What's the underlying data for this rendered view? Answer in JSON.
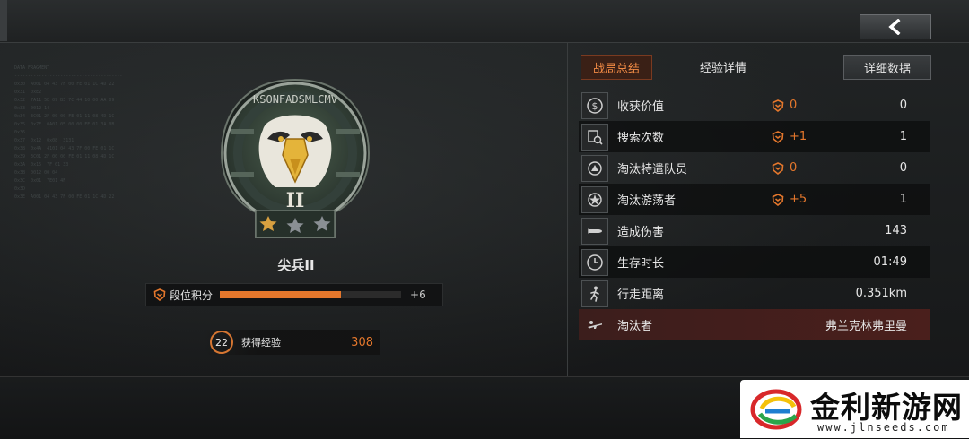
{
  "colors": {
    "accent": "#e4772c",
    "killer_bg": "#4a1f1c",
    "panel_bg": "#1c1e1f"
  },
  "header": {
    "back_icon": "chevron-left-icon"
  },
  "rank": {
    "badge_text": "KSONFADSMLCMV",
    "badge_numeral": "II",
    "stars_filled": 1,
    "stars_total": 3,
    "name": "尖兵II"
  },
  "score": {
    "label": "段位积分",
    "progress": 0.67,
    "delta": "+6"
  },
  "experience": {
    "level": "22",
    "label": "获得经验",
    "value": "308"
  },
  "tabs": {
    "summary": "战局总结",
    "exp_details": "经验详情",
    "detailed_data": "详细数据"
  },
  "stats": [
    {
      "icon": "money-icon",
      "label": "收获价值",
      "bonus": "0",
      "value": "0"
    },
    {
      "icon": "search-icon",
      "label": "搜索次数",
      "bonus": "+1",
      "value": "1"
    },
    {
      "icon": "special-ops-icon",
      "label": "淘汰特遣队员",
      "bonus": "0",
      "value": "0"
    },
    {
      "icon": "raider-icon",
      "label": "淘汰游荡者",
      "bonus": "+5",
      "value": "1"
    },
    {
      "icon": "bullet-icon",
      "label": "造成伤害",
      "bonus": "",
      "value": "143"
    },
    {
      "icon": "clock-icon",
      "label": "生存时长",
      "bonus": "",
      "value": "01:49"
    },
    {
      "icon": "walk-icon",
      "label": "行走距离",
      "bonus": "",
      "value": "0.351km"
    },
    {
      "icon": "rifle-icon",
      "label": "淘汰者",
      "bonus": "",
      "value": "弗兰克林弗里曼"
    }
  ],
  "watermark": {
    "title": "金利新游网",
    "url": "www.jlnseeds.com"
  }
}
